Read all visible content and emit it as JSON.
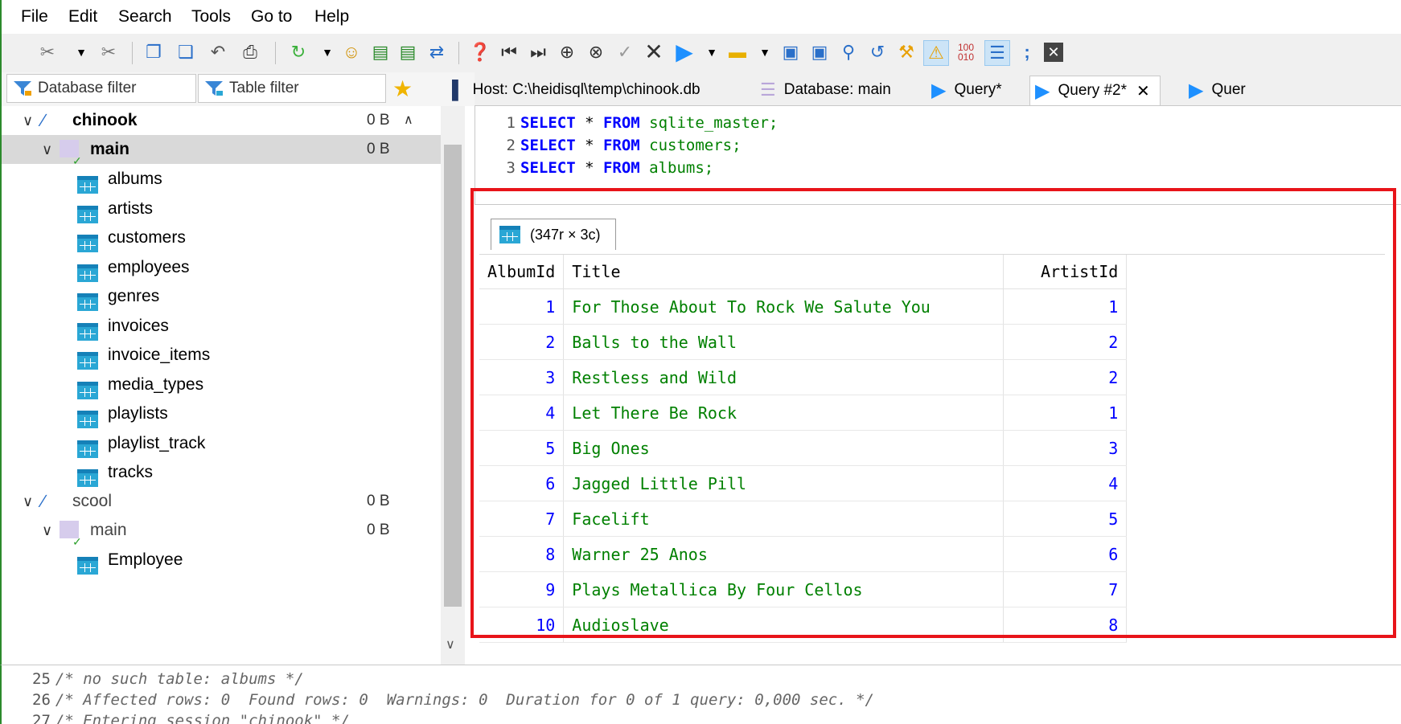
{
  "menu": [
    "File",
    "Edit",
    "Search",
    "Tools",
    "Go to",
    "Help"
  ],
  "filters": {
    "database_filter": "Database filter",
    "table_filter": "Table filter"
  },
  "tabs": [
    {
      "label": "Host: C:\\heidisql\\temp\\chinook.db",
      "icon": "host-icon"
    },
    {
      "label": "Database: main",
      "icon": "database-icon"
    },
    {
      "label": "Query*",
      "icon": "query-play-icon"
    },
    {
      "label": "Query #2*",
      "icon": "query-play-icon",
      "selected": true,
      "close": "✕"
    },
    {
      "label": "Quer",
      "icon": "query-play-icon"
    }
  ],
  "tree": {
    "db1": {
      "name": "chinook",
      "size": "0 B"
    },
    "schema1": {
      "name": "main",
      "size": "0 B"
    },
    "tables1": [
      "albums",
      "artists",
      "customers",
      "employees",
      "genres",
      "invoices",
      "invoice_items",
      "media_types",
      "playlists",
      "playlist_track",
      "tracks"
    ],
    "db2": {
      "name": "scool",
      "size": "0 B"
    },
    "schema2": {
      "name": "main",
      "size": "0 B"
    },
    "tables2": [
      "Employee"
    ]
  },
  "editor": {
    "lines": [
      {
        "n": "1",
        "kw1": "SELECT",
        "star": " * ",
        "kw2": "FROM",
        "ident": " sqlite_master;"
      },
      {
        "n": "2",
        "kw1": "SELECT",
        "star": " * ",
        "kw2": "FROM",
        "ident": " customers;"
      },
      {
        "n": "3",
        "kw1": "SELECT",
        "star": " * ",
        "kw2": "FROM",
        "ident": " albums;"
      }
    ]
  },
  "result": {
    "tab_label": "(347r × 3c)",
    "columns": [
      "AlbumId",
      "Title",
      "ArtistId"
    ],
    "rows": [
      [
        "1",
        "For Those About To Rock We Salute You",
        "1"
      ],
      [
        "2",
        "Balls to the Wall",
        "2"
      ],
      [
        "3",
        "Restless and Wild",
        "2"
      ],
      [
        "4",
        "Let There Be Rock",
        "1"
      ],
      [
        "5",
        "Big Ones",
        "3"
      ],
      [
        "6",
        "Jagged Little Pill",
        "4"
      ],
      [
        "7",
        "Facelift",
        "5"
      ],
      [
        "8",
        "Warner 25 Anos",
        "6"
      ],
      [
        "9",
        "Plays Metallica By Four Cellos",
        "7"
      ],
      [
        "10",
        "Audioslave",
        "8"
      ]
    ]
  },
  "log": [
    {
      "n": "25",
      "text": "/* no such table: albums */"
    },
    {
      "n": "26",
      "text": "/* Affected rows: 0  Found rows: 0  Warnings: 0  Duration for 0 of 1 query: 0,000 sec. */"
    },
    {
      "n": "27",
      "text": "/* Entering session \"chinook\" */"
    }
  ],
  "colors": {
    "highlight": "#e8141a",
    "number": "#0000ff",
    "text_value": "#008000",
    "keyword": "#0000ff"
  }
}
